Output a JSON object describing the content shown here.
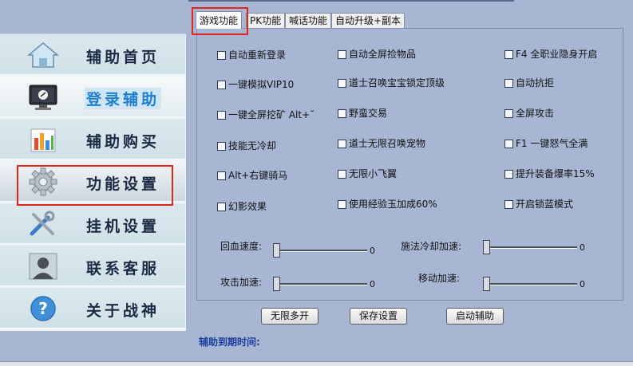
{
  "sidebar": {
    "items": [
      {
        "label": "辅助首页",
        "icon": "home-icon"
      },
      {
        "label": "登录辅助",
        "icon": "monitor-icon"
      },
      {
        "label": "辅助购买",
        "icon": "bar-chart-icon"
      },
      {
        "label": "功能设置",
        "icon": "gear-icon"
      },
      {
        "label": "挂机设置",
        "icon": "tools-icon"
      },
      {
        "label": "联系客服",
        "icon": "user-icon"
      },
      {
        "label": "关于战神",
        "icon": "help-icon"
      }
    ]
  },
  "tabs": [
    {
      "label": "游戏功能"
    },
    {
      "label": "PK功能"
    },
    {
      "label": "喊话功能"
    },
    {
      "label": "自动升级+副本"
    }
  ],
  "options": [
    {
      "label": "自动重新登录"
    },
    {
      "label": "自动全屏捡物品"
    },
    {
      "label": "F4 全职业隐身开启"
    },
    {
      "label": "一键模拟VIP10"
    },
    {
      "label": "道士召唤宝宝锁定顶级"
    },
    {
      "label": "自动抗拒"
    },
    {
      "label": "一键全屏挖矿 Alt+˘"
    },
    {
      "label": "野蛮交易"
    },
    {
      "label": "全屏攻击"
    },
    {
      "label": "技能无冷却"
    },
    {
      "label": "道士无限召唤宠物"
    },
    {
      "label": "F1 一键怒气全满"
    },
    {
      "label": "Alt+右键骑马"
    },
    {
      "label": "无限小飞翼"
    },
    {
      "label": "提升装备爆率15%"
    },
    {
      "label": "幻影效果"
    },
    {
      "label": "使用经验玉加成60%"
    },
    {
      "label": "开启锁蓝模式"
    }
  ],
  "sliders": [
    {
      "label": "回血速度:",
      "value": "0"
    },
    {
      "label": "施法冷却加速:",
      "value": "0"
    },
    {
      "label": "攻击加速:",
      "value": "0"
    },
    {
      "label": "移动加速:",
      "value": "0"
    }
  ],
  "buttons": {
    "multi_open": "无限多开",
    "save": "保存设置",
    "start": "启动辅助"
  },
  "expire_label": "辅助到期时间:",
  "colors": {
    "highlight_border": "#e0251b",
    "selected_text": "#1e7fd0",
    "window_bg": "#a7b6d3"
  }
}
